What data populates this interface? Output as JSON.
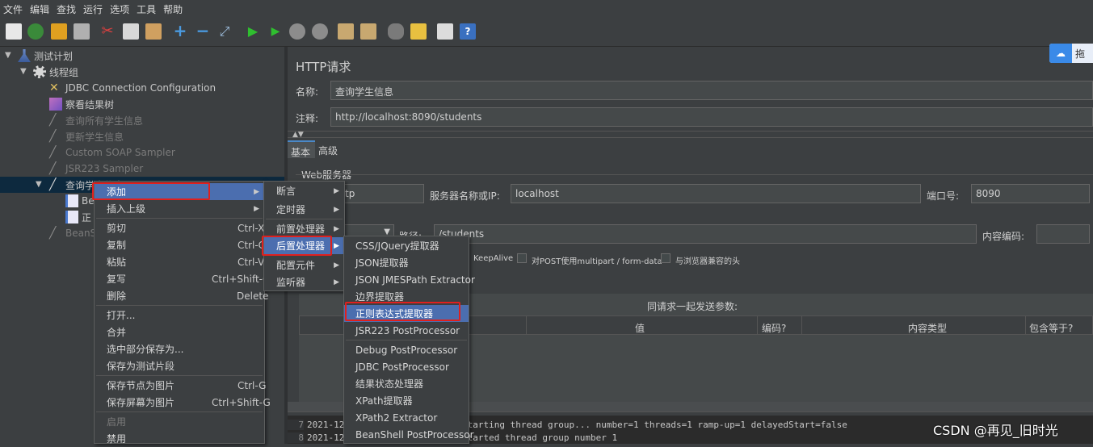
{
  "menubar": [
    "文件",
    "编辑",
    "查找",
    "运行",
    "选项",
    "工具",
    "帮助"
  ],
  "tree": {
    "nodes": [
      {
        "label": "测试计划",
        "icon": "test-plan-icon",
        "enabled": true
      },
      {
        "label": "线程组",
        "icon": "gear-icon",
        "enabled": true
      },
      {
        "label": "JDBC Connection Configuration",
        "icon": "wrench-icon",
        "enabled": true
      },
      {
        "label": "察看结果树",
        "icon": "chart-icon",
        "enabled": true
      },
      {
        "label": "查询所有学生信息",
        "icon": "pen-icon",
        "enabled": false
      },
      {
        "label": "更新学生信息",
        "icon": "pen-icon",
        "enabled": false
      },
      {
        "label": "Custom SOAP Sampler",
        "icon": "pen-icon",
        "enabled": false
      },
      {
        "label": "JSR223 Sampler",
        "icon": "pen-icon",
        "enabled": false
      },
      {
        "label": "查询学生信息",
        "icon": "pen-icon",
        "enabled": true
      },
      {
        "label": "Be",
        "icon": "document-icon",
        "enabled": true
      },
      {
        "label": "正",
        "icon": "document-icon",
        "enabled": true
      },
      {
        "label": "BeanS",
        "icon": "pen-icon",
        "enabled": false
      }
    ]
  },
  "http": {
    "title": "HTTP请求",
    "name_label": "名称:",
    "name_value": "查询学生信息",
    "comment_label": "注释:",
    "comment_value": "http://localhost:8090/students",
    "tabs": [
      "基本",
      "高级"
    ],
    "web_server_label": "Web服务器",
    "protocol_value": "tp",
    "server_label": "服务器名称或IP:",
    "server_value": "localhost",
    "port_label": "端口号:",
    "port_value": "8090",
    "path_label": "路径:",
    "path_value": "/students",
    "encoding_label": "内容编码:",
    "keepalive_label": "KeepAlive",
    "multipart_label": "对POST使用multipart / form-data",
    "browser_headers_label": "与浏览器兼容的头",
    "params_title": "同请求一起发送参数:",
    "columns": [
      "值",
      "编码?",
      "内容类型",
      "包含等于?"
    ]
  },
  "context_menu": {
    "items": [
      {
        "label": "添加",
        "shortcut": ""
      },
      {
        "label": "插入上级",
        "shortcut": ""
      },
      {
        "label": "剪切",
        "shortcut": "Ctrl-X"
      },
      {
        "label": "复制",
        "shortcut": "Ctrl-C"
      },
      {
        "label": "粘贴",
        "shortcut": "Ctrl-V"
      },
      {
        "label": "复写",
        "shortcut": "Ctrl+Shift-C"
      },
      {
        "label": "删除",
        "shortcut": "Delete"
      },
      {
        "label": "打开...",
        "shortcut": ""
      },
      {
        "label": "合并",
        "shortcut": ""
      },
      {
        "label": "选中部分保存为...",
        "shortcut": ""
      },
      {
        "label": "保存为测试片段",
        "shortcut": ""
      },
      {
        "label": "保存节点为图片",
        "shortcut": "Ctrl-G"
      },
      {
        "label": "保存屏幕为图片",
        "shortcut": "Ctrl+Shift-G"
      },
      {
        "label": "启用",
        "shortcut": ""
      },
      {
        "label": "禁用",
        "shortcut": ""
      }
    ]
  },
  "add_submenu": {
    "items": [
      "断言",
      "定时器",
      "前置处理器",
      "后置处理器",
      "配置元件",
      "监听器"
    ]
  },
  "post_processor_submenu": {
    "items": [
      "CSS/JQuery提取器",
      "JSON提取器",
      "JSON JMESPath Extractor",
      "边界提取器",
      "正则表达式提取器",
      "JSR223 PostProcessor",
      "Debug PostProcessor",
      "JDBC PostProcessor",
      "结果状态处理器",
      "XPath提取器",
      "XPath2 Extractor",
      "BeanShell PostProcessor"
    ]
  },
  "console": {
    "lines": [
      {
        "num": "7",
        "text": "2021-12          o.a.j.t.ThreadGroup: Starting thread group... number=1 threads=1 ramp-up=1 delayedStart=false"
      },
      {
        "num": "8",
        "text": "2021-12          o.a.j.t.ThreadGroup: Started thread group number 1"
      }
    ]
  },
  "watermark": "CSDN @再见_旧时光",
  "badge_text": "拖",
  "colors": {
    "selection": "#4b6eaf",
    "highlight_box": "#e0201e",
    "background": "#3c3f41"
  }
}
